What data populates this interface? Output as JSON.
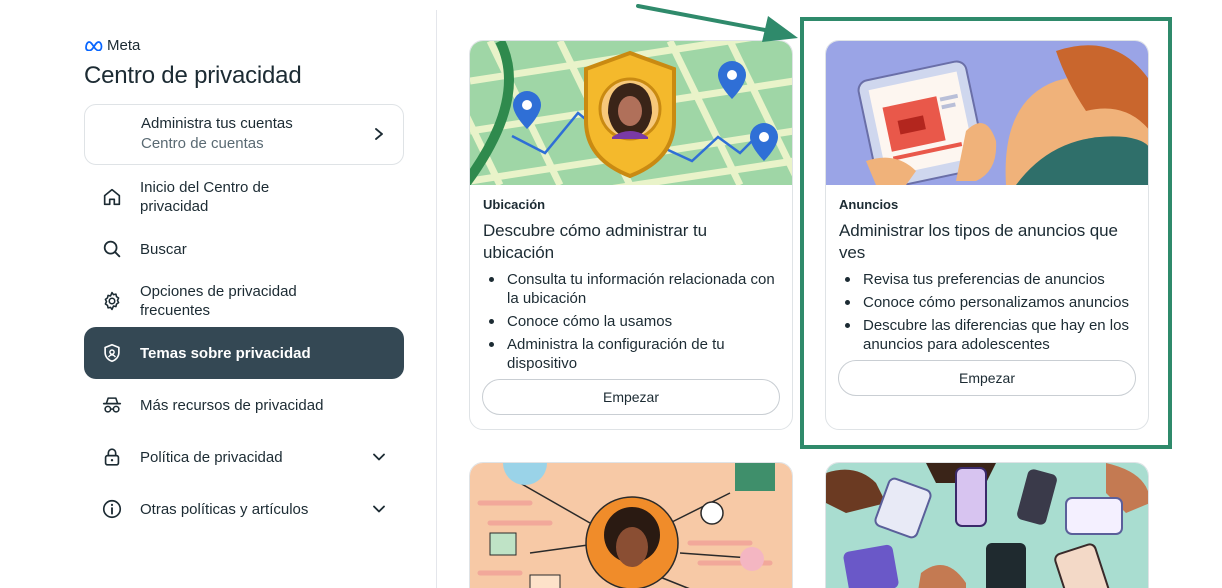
{
  "brand": {
    "name": "Meta"
  },
  "page_title": "Centro de privacidad",
  "account_card": {
    "title": "Administra tus cuentas",
    "subtitle": "Centro de cuentas"
  },
  "nav": [
    {
      "label": "Inicio del Centro de privacidad",
      "icon": "home-icon"
    },
    {
      "label": "Buscar",
      "icon": "search-icon"
    },
    {
      "label": "Opciones de privacidad frecuentes",
      "icon": "gear-icon"
    },
    {
      "label": "Temas sobre privacidad",
      "icon": "shield-icon",
      "active": true
    },
    {
      "label": "Más recursos de privacidad",
      "icon": "incognito-icon"
    },
    {
      "label": "Política de privacidad",
      "icon": "lock-icon",
      "expandable": true
    },
    {
      "label": "Otras políticas y artículos",
      "icon": "info-icon",
      "expandable": true
    }
  ],
  "cards": [
    {
      "category": "Ubicación",
      "title": "Descubre cómo administrar tu ubicación",
      "bullets": [
        "Consulta tu información relacionada con la ubicación",
        "Conoce cómo la usamos",
        "Administra la configuración de tu dispositivo"
      ],
      "button": "Empezar"
    },
    {
      "category": "Anuncios",
      "title": "Administrar los tipos de anuncios que ves",
      "bullets": [
        "Revisa tus preferencias de anuncios",
        "Conoce cómo personalizamos anuncios",
        "Descubre las diferencias que hay en los anuncios para adolescentes"
      ],
      "button": "Empezar"
    }
  ],
  "colors": {
    "active_nav_bg": "#344854",
    "highlight": "#2f8a6b",
    "map_green": "#9fd6a6",
    "ads_blue": "#9aa4e6",
    "peach": "#f7c9a6",
    "mint": "#a9ddd0"
  }
}
